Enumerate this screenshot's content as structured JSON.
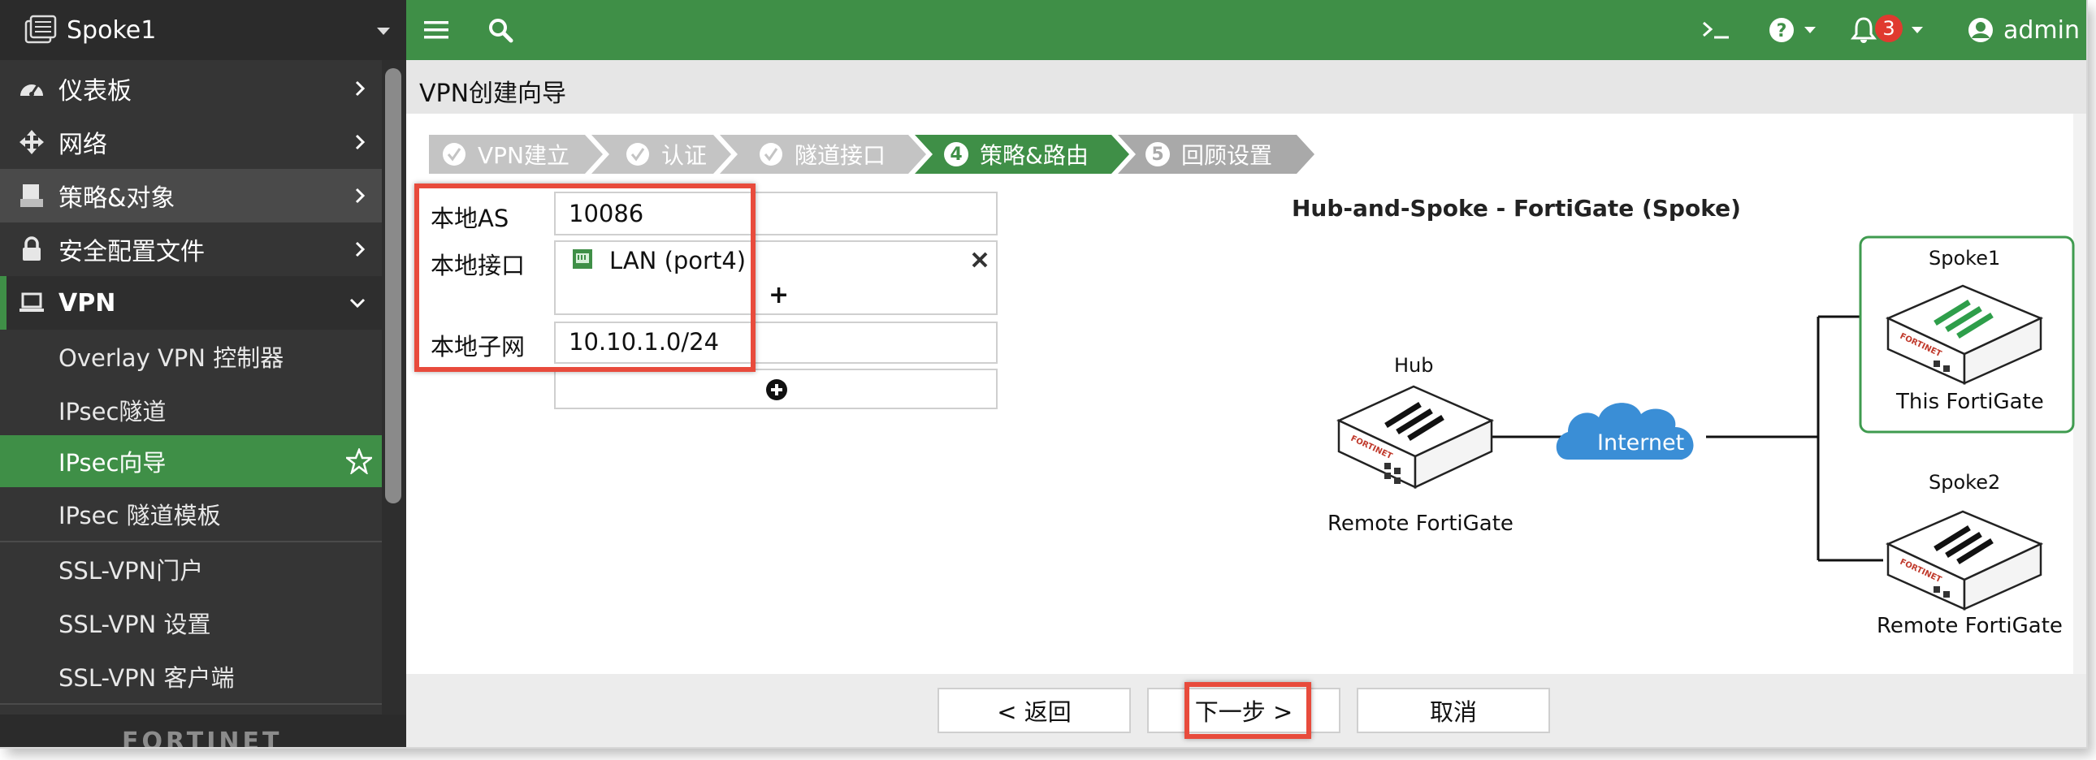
{
  "sidebar": {
    "device_name": "Spoke1",
    "items": [
      {
        "label": "仪表板",
        "icon": "dashboard-icon"
      },
      {
        "label": "网络",
        "icon": "network-move-icon"
      },
      {
        "label": "策略&对象",
        "icon": "policy-icon"
      },
      {
        "label": "安全配置文件",
        "icon": "lock-icon"
      },
      {
        "label": "VPN",
        "icon": "laptop-icon"
      }
    ],
    "vpn_subitems": [
      {
        "label": "Overlay VPN 控制器"
      },
      {
        "label": "IPsec隧道"
      },
      {
        "label": "IPsec向导"
      },
      {
        "label": "IPsec 隧道模板"
      },
      {
        "label": "SSL-VPN门户"
      },
      {
        "label": "SSL-VPN 设置"
      },
      {
        "label": "SSL-VPN 客户端"
      }
    ],
    "logo_text": "FORTINET"
  },
  "topbar": {
    "notification_count": "3",
    "user": "admin"
  },
  "wizard": {
    "title": "VPN创建向导",
    "steps": [
      {
        "label": "VPN建立",
        "state": "done"
      },
      {
        "label": "认证",
        "state": "done"
      },
      {
        "label": "隧道接口",
        "state": "done"
      },
      {
        "label": "策略&路由",
        "state": "active",
        "num": "4"
      },
      {
        "label": "回顾设置",
        "state": "todo",
        "num": "5"
      }
    ]
  },
  "form": {
    "local_as_label": "本地AS",
    "local_as_value": "10086",
    "local_interface_label": "本地接口",
    "local_interface_value": "LAN (port4)",
    "add_symbol": "+",
    "local_subnet_label": "本地子网",
    "local_subnet_value": "10.10.1.0/24"
  },
  "diagram": {
    "title": "Hub-and-Spoke - FortiGate (Spoke)",
    "hub_label": "Hub",
    "hub_caption": "Remote FortiGate",
    "internet_label": "Internet",
    "spoke1_label": "Spoke1",
    "spoke1_caption": "This FortiGate",
    "spoke2_label": "Spoke2",
    "spoke2_caption": "Remote FortiGate",
    "device_brand": "FORTINET",
    "colors": {
      "internet": "#3a8ed6",
      "spoke1_stripes": "#2e9e4a",
      "highlight_border": "#3f9b4f"
    }
  },
  "buttons": {
    "back": "< 返回",
    "next": "下一步 >",
    "cancel": "取消"
  },
  "colors": {
    "topbar": "#3f8f47",
    "sidebar": "#353535",
    "active_menu": "#3f8f47",
    "highlight": "#e84b3c"
  }
}
